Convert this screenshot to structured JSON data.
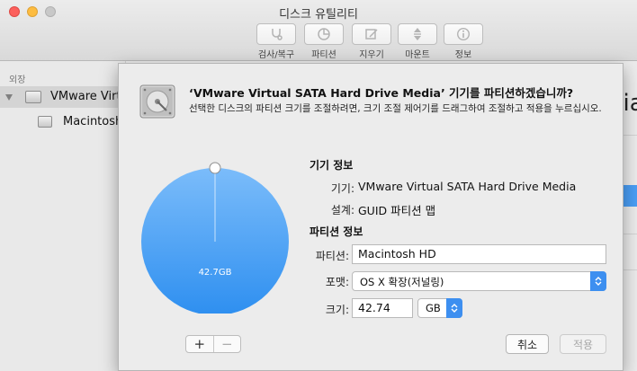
{
  "window": {
    "title": "디스크 유틸리티"
  },
  "toolbar": {
    "items": [
      {
        "label": "검사/복구",
        "icon": "stethoscope-icon"
      },
      {
        "label": "파티션",
        "icon": "partition-pie-icon"
      },
      {
        "label": "지우기",
        "icon": "erase-icon"
      },
      {
        "label": "마운트",
        "icon": "mount-icon"
      },
      {
        "label": "정보",
        "icon": "info-icon"
      }
    ]
  },
  "sidebar": {
    "header": "외장",
    "items": [
      {
        "label": "VMware Virtual SATA Hard Drive Media",
        "selected": true
      },
      {
        "label": "Macintosh HD",
        "selected": false
      }
    ]
  },
  "background": {
    "right_heading": "dia"
  },
  "sheet": {
    "title": "‘VMware Virtual SATA Hard Drive Media’ 기기를 파티션하겠습니까?",
    "description": "선택한 디스크의 파티션 크기를 조절하려면, 크기 조절 제어기를 드래그하여 조절하고 적용을 누르십시오.",
    "pie": {
      "label": "42.7GB",
      "fill_fraction": 1.0,
      "color": "#4a9ef5"
    },
    "device_info": {
      "heading": "기기 정보",
      "device_label": "기기:",
      "device_value": "VMware Virtual SATA Hard Drive Media",
      "scheme_label": "설계:",
      "scheme_value": "GUID 파티션 맵"
    },
    "partition_info": {
      "heading": "파티션 정보",
      "name_label": "파티션:",
      "name_value": "Macintosh HD",
      "format_label": "포맷:",
      "format_value": "OS X 확장(저널링)",
      "size_label": "크기:",
      "size_value": "42.74",
      "unit_value": "GB"
    },
    "add_label": "+",
    "remove_label": "−",
    "cancel_label": "취소",
    "apply_label": "적용"
  }
}
